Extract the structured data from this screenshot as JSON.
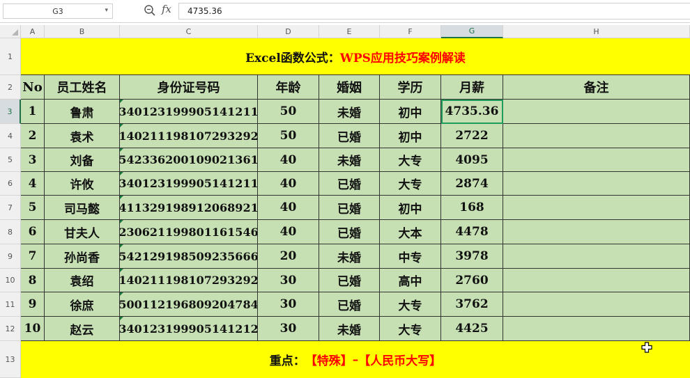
{
  "formula_bar": {
    "name_box": "G3",
    "formula": "4735.36",
    "fx_label": "fx"
  },
  "columns": [
    "A",
    "B",
    "C",
    "D",
    "E",
    "F",
    "G",
    "H"
  ],
  "selected_column": "G",
  "rows": [
    "1",
    "2",
    "3",
    "4",
    "5",
    "6",
    "7",
    "8",
    "9",
    "10",
    "11",
    "12",
    "13"
  ],
  "selected_row": "3",
  "title": {
    "part1": "Excel函数公式：",
    "part2": "WPS应用技巧案例解读"
  },
  "header": {
    "no": "No",
    "name": "员工姓名",
    "id": "身份证号码",
    "age": "年龄",
    "marital": "婚姻",
    "education": "学历",
    "salary": "月薪",
    "note": "备注"
  },
  "records": [
    {
      "no": "1",
      "name": "鲁肃",
      "id": "340123199905141211",
      "age": "50",
      "marital": "未婚",
      "education": "初中",
      "salary": "4735.36",
      "note": ""
    },
    {
      "no": "2",
      "name": "袁术",
      "id": "140211198107293292",
      "age": "50",
      "marital": "已婚",
      "education": "初中",
      "salary": "2722",
      "note": ""
    },
    {
      "no": "3",
      "name": "刘备",
      "id": "542336200109021361",
      "age": "40",
      "marital": "未婚",
      "education": "大专",
      "salary": "4095",
      "note": ""
    },
    {
      "no": "4",
      "name": "许攸",
      "id": "340123199905141211",
      "age": "40",
      "marital": "已婚",
      "education": "大专",
      "salary": "2874",
      "note": ""
    },
    {
      "no": "5",
      "name": "司马懿",
      "id": "411329198912068921",
      "age": "40",
      "marital": "已婚",
      "education": "初中",
      "salary": "168",
      "note": ""
    },
    {
      "no": "6",
      "name": "甘夫人",
      "id": "230621199801161546",
      "age": "40",
      "marital": "已婚",
      "education": "大本",
      "salary": "4478",
      "note": ""
    },
    {
      "no": "7",
      "name": "孙尚香",
      "id": "542129198509235666",
      "age": "20",
      "marital": "未婚",
      "education": "中专",
      "salary": "3978",
      "note": ""
    },
    {
      "no": "8",
      "name": "袁绍",
      "id": "140211198107293292",
      "age": "30",
      "marital": "已婚",
      "education": "高中",
      "salary": "2760",
      "note": ""
    },
    {
      "no": "9",
      "name": "徐庶",
      "id": "500112196809204784",
      "age": "30",
      "marital": "已婚",
      "education": "大专",
      "salary": "3762",
      "note": ""
    },
    {
      "no": "10",
      "name": "赵云",
      "id": "340123199905141212",
      "age": "30",
      "marital": "未婚",
      "education": "大专",
      "salary": "4425",
      "note": ""
    }
  ],
  "footer": {
    "label": "重点：",
    "part1": "【特殊】",
    "sep": "–",
    "part2": "【人民币大写】"
  },
  "colors": {
    "title_bg": "#ffff00",
    "cell_bg": "#c6e0b4",
    "accent_red": "#ff0000",
    "selection": "#1e9c5a"
  }
}
